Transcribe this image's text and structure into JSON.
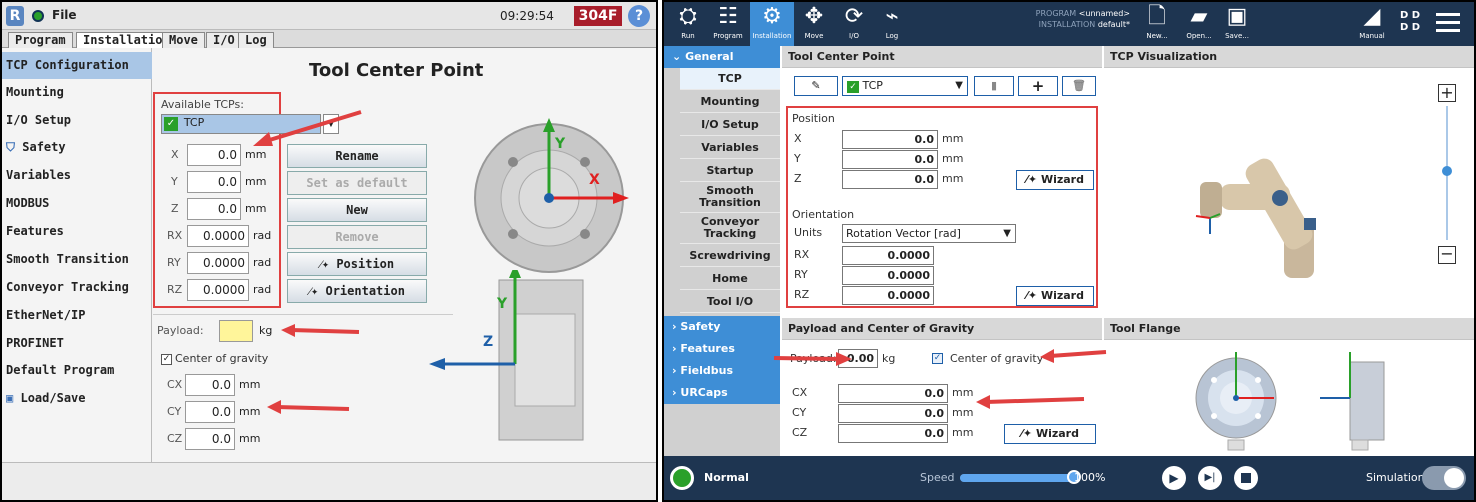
{
  "left": {
    "titlebar": {
      "file": "File",
      "time": "09:29:54",
      "status_code": "304F"
    },
    "tabs": [
      "Program",
      "Installation",
      "Move",
      "I/O",
      "Log"
    ],
    "sidebar": [
      {
        "label": "TCP Configuration",
        "selected": true
      },
      {
        "label": "Mounting"
      },
      {
        "label": "I/O Setup"
      },
      {
        "label": "Safety",
        "icon": "shield-icon"
      },
      {
        "label": "Variables"
      },
      {
        "label": "MODBUS"
      },
      {
        "label": "Features"
      },
      {
        "label": "Smooth Transition"
      },
      {
        "label": "Conveyor Tracking"
      },
      {
        "label": "EtherNet/IP"
      },
      {
        "label": "PROFINET"
      },
      {
        "label": "Default Program"
      },
      {
        "label": "Load/Save",
        "icon": "save-icon"
      }
    ],
    "title": "Tool Center Point",
    "available_label": "Available TCPs:",
    "tcp_selected": "TCP",
    "fields": [
      {
        "label": "X",
        "value": "0.0",
        "unit": "mm"
      },
      {
        "label": "Y",
        "value": "0.0",
        "unit": "mm"
      },
      {
        "label": "Z",
        "value": "0.0",
        "unit": "mm"
      },
      {
        "label": "RX",
        "value": "0.0000",
        "unit": "rad"
      },
      {
        "label": "RY",
        "value": "0.0000",
        "unit": "rad"
      },
      {
        "label": "RZ",
        "value": "0.0000",
        "unit": "rad"
      }
    ],
    "buttons": [
      {
        "label": "Rename",
        "enabled": true
      },
      {
        "label": "Set as default",
        "enabled": false
      },
      {
        "label": "New",
        "enabled": true
      },
      {
        "label": "Remove",
        "enabled": false
      },
      {
        "label": "Position",
        "enabled": true,
        "icon": "wand-icon"
      },
      {
        "label": "Orientation",
        "enabled": true,
        "icon": "wand-icon"
      }
    ],
    "payload_label": "Payload:",
    "payload_value": "",
    "payload_unit": "kg",
    "cog_label": "Center of gravity",
    "cog_checked": true,
    "cog": [
      {
        "label": "CX",
        "value": "0.0",
        "unit": "mm"
      },
      {
        "label": "CY",
        "value": "0.0",
        "unit": "mm"
      },
      {
        "label": "CZ",
        "value": "0.0",
        "unit": "mm"
      }
    ],
    "axes": {
      "x": "X",
      "y": "Y",
      "z": "Z"
    }
  },
  "right": {
    "toolbar": {
      "run": "Run",
      "program": "Program",
      "installation": "Installation",
      "move": "Move",
      "io": "I/O",
      "log": "Log",
      "program_label": "PROGRAM",
      "program_value": "<unnamed>",
      "installation_label": "INSTALLATION",
      "installation_value": "default*",
      "new": "New...",
      "open": "Open...",
      "save": "Save...",
      "manual": "Manual",
      "dd1": "D D",
      "dd2": "D D"
    },
    "nav": {
      "general": "General",
      "items": [
        "TCP",
        "Mounting",
        "I/O Setup",
        "Variables",
        "Startup",
        "Smooth Transition",
        "Conveyor Tracking",
        "Screwdriving",
        "Home",
        "Tool I/O"
      ],
      "categories": [
        "Safety",
        "Features",
        "Fieldbus",
        "URCaps"
      ]
    },
    "tcp_panel": {
      "header": "Tool Center Point",
      "tcp_selected": "TCP",
      "position_label": "Position",
      "pos": [
        {
          "label": "X",
          "value": "0.0",
          "unit": "mm"
        },
        {
          "label": "Y",
          "value": "0.0",
          "unit": "mm"
        },
        {
          "label": "Z",
          "value": "0.0",
          "unit": "mm"
        }
      ],
      "wizard": "Wizard",
      "orientation_label": "Orientation",
      "units_label": "Units",
      "units_value": "Rotation Vector [rad]",
      "rot": [
        {
          "label": "RX",
          "value": "0.0000"
        },
        {
          "label": "RY",
          "value": "0.0000"
        },
        {
          "label": "RZ",
          "value": "0.0000"
        }
      ]
    },
    "vis_header": "TCP Visualization",
    "payload_panel": {
      "header": "Payload and Center of Gravity",
      "payload_label": "Payload:",
      "payload_value": "0.00",
      "payload_unit": "kg",
      "cog_label": "Center of gravity",
      "cog": [
        {
          "label": "CX",
          "value": "0.0",
          "unit": "mm"
        },
        {
          "label": "CY",
          "value": "0.0",
          "unit": "mm"
        },
        {
          "label": "CZ",
          "value": "0.0",
          "unit": "mm"
        }
      ],
      "wizard": "Wizard"
    },
    "flange_header": "Tool Flange",
    "bottom": {
      "mode": "Normal",
      "speed_label": "Speed",
      "speed_value": "100%",
      "speed_fraction": 1.0,
      "simulation": "Simulation"
    }
  },
  "colors": {
    "ur_dark": "#1e3551",
    "ur_blue": "#3e8ed6",
    "highlight_red": "#e04040",
    "payload_yellow": "#fff59a"
  }
}
